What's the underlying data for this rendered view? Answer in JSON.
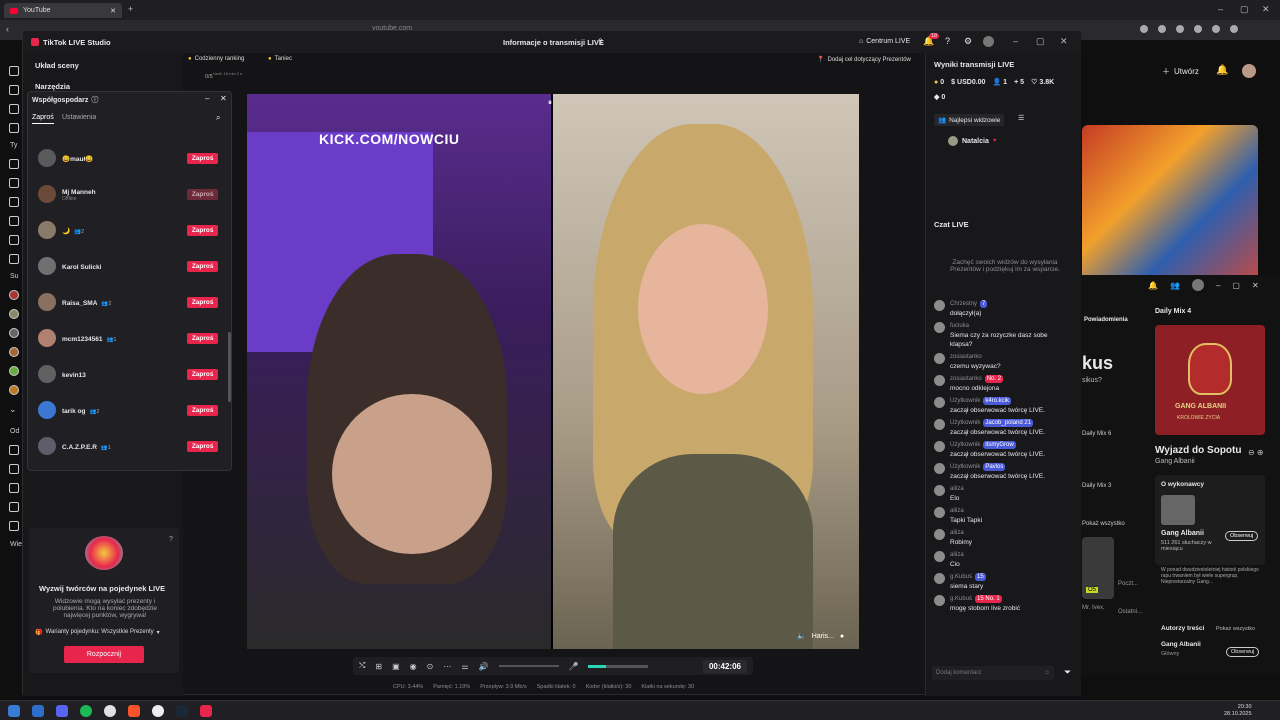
{
  "browser": {
    "tab_title": "YouTube",
    "address": "youtube.com",
    "nav_labels": [
      "Ty",
      "Su",
      "Od",
      "Wie"
    ]
  },
  "youtube": {
    "create_label": "Utwórz",
    "thumb_badge": "3:44"
  },
  "tiktok": {
    "app_title": "TikTok LIVE Studio",
    "window_center_title": "Informacje o transmisji LIVE",
    "centrum_label": "Centrum LIVE",
    "notif_count": "18",
    "left_menu": {
      "uklad_sceny": "Układ sceny",
      "narzedzia": "Narzędzia"
    },
    "top_tags": {
      "ranking": "Codzienny ranking",
      "taniec": "Taniec",
      "goal": "Dodaj cel dotyczący Prezentów",
      "small_counter": "0/5",
      "small_note": "Limit: 18 min 2 s"
    },
    "cohost": {
      "title": "Współgospodarz",
      "tab_invite": "Zaproś",
      "tab_settings": "Ustawienia",
      "invite_label": "Zaproś",
      "rows": [
        {
          "name": "😀mauł😀",
          "sub": "",
          "badge": "",
          "dim": false
        },
        {
          "name": "Mj Manneh",
          "sub": "Offline",
          "badge": "",
          "dim": true
        },
        {
          "name": "🌙",
          "sub": "",
          "badge": "👥2",
          "dim": false
        },
        {
          "name": "Karol Sulicki",
          "sub": "",
          "badge": "",
          "dim": false
        },
        {
          "name": "Raisa_SMA",
          "sub": "",
          "badge": "👥2",
          "dim": false
        },
        {
          "name": "mcm1234561",
          "sub": "",
          "badge": "👥1",
          "dim": false
        },
        {
          "name": "kevin13",
          "sub": "",
          "badge": "",
          "dim": false
        },
        {
          "name": "tarik og",
          "sub": "",
          "badge": "👥2",
          "dim": false
        },
        {
          "name": "C.A.Z.P.E.R",
          "sub": "",
          "badge": "👥1",
          "dim": false
        }
      ]
    },
    "battle": {
      "title": "Wyzwij twórców na pojedynek LIVE",
      "desc": "Widzowie mogą wysyłać prezenty i polubienia. Kto na koniec zdobędzie najwięcej punktów, wygrywa!",
      "variants": "Warianty pojedynku: Wszystkie Prezenty",
      "start": "Rozpocznij"
    },
    "video": {
      "overlay_text": "KICK.COM/NOWCIU",
      "guest_name": "Haris...",
      "timer": "00:42:06"
    },
    "stats_bar": {
      "cpu": "CPU: 3.44%",
      "mem": "Pamięć: 1.19%",
      "bitrate": "Przepływ: 3.9 Mb/s",
      "dropped": "Spadki klatek: 0",
      "encoder": "Koder (klatki/s): 30",
      "fps": "Klatki na sekundę: 30"
    },
    "results": {
      "title": "Wyniki transmisji LIVE",
      "coins": "0",
      "usd": "USD0.00",
      "viewers": "1",
      "followers": "5",
      "likes": "3.8K",
      "diamonds": "0",
      "top_viewers_label": "Najlepsi widzowie",
      "top_viewer": "Natalcia"
    },
    "chat": {
      "title": "Czat LIVE",
      "prompt": "Zachęć swoich widzów do wysyłania Prezentów i podziękuj im za wsparcie.",
      "input_placeholder": "Dodaj komentarz",
      "messages": [
        {
          "user": "Chrzestny",
          "badge": "7",
          "text": "dołączył(a)"
        },
        {
          "user": "fuciuka",
          "badge": "",
          "text": "Siema czy za rozyczke dasz sobe klapsa?"
        },
        {
          "user": "zosiastanko",
          "badge": "",
          "text": "czemu wyzywac?"
        },
        {
          "user": "zosiastanko",
          "badge": "No. 2",
          "text": "mocno odklejona"
        },
        {
          "user": "Użytkownik",
          "badge": "k4ro.kcik",
          "text": "zaczął obserwować twórcę LIVE."
        },
        {
          "user": "Użytkownik",
          "badge": "Jacob_poland 21",
          "text": "zaczął obserwować twórcę LIVE."
        },
        {
          "user": "Użytkownik",
          "badge": "itsmyGrow",
          "text": "zaczął obserwować twórcę LIVE."
        },
        {
          "user": "Użytkownik",
          "badge": "Pavlos",
          "text": "zaczął obserwować twórcę LIVE."
        },
        {
          "user": "aliiza",
          "badge": "",
          "text": "Elo"
        },
        {
          "user": "aliiza",
          "badge": "",
          "text": "Tapki Tapki"
        },
        {
          "user": "aliiza",
          "badge": "",
          "text": "Robimy"
        },
        {
          "user": "aliiza",
          "badge": "",
          "text": "Cio"
        },
        {
          "user": "g.Kubuś",
          "badge": "15",
          "text": "siema stary"
        },
        {
          "user": "g.Kubuś",
          "badge": "15 No. 1",
          "text": "mogę stobom live zrobić"
        }
      ]
    }
  },
  "music": {
    "notifications": "Powiadomienia",
    "kus": "kus",
    "sikus": "sikus?",
    "daily4": "Daily Mix 4",
    "daily6": "Daily Mix 6",
    "daily3": "Daily Mix 3",
    "album_title": "GANG ALBANII",
    "album_sub": "KROLOWIE ZYCIA",
    "track": "Wyjazd do Sopotu",
    "artist": "Gang Albanii",
    "about_artist": "O wykonawcy",
    "artist_name": "Gang Albanii",
    "listeners": "511 261 słuchaczy w miesiącu",
    "follow": "Obserwuj",
    "bio": "W ponad dwudziestoletniej historii polskiego rapu trwaniem był wiele supergrup. Niepowtarzalny Gang...",
    "show_all": "Pokaż wszystko",
    "credits": "Autorzy treści",
    "credits_show": "Pokaż wszystko",
    "credit_name": "Gang Albanii",
    "credit_role": "Główny",
    "mr_ivex": "Mr. Ivex,",
    "poczt": "Poczt...",
    "ostatni": "Ostatni...",
    "badge_05": "O5"
  },
  "taskbar": {
    "time": "20:30",
    "date": "28.10.2025"
  }
}
